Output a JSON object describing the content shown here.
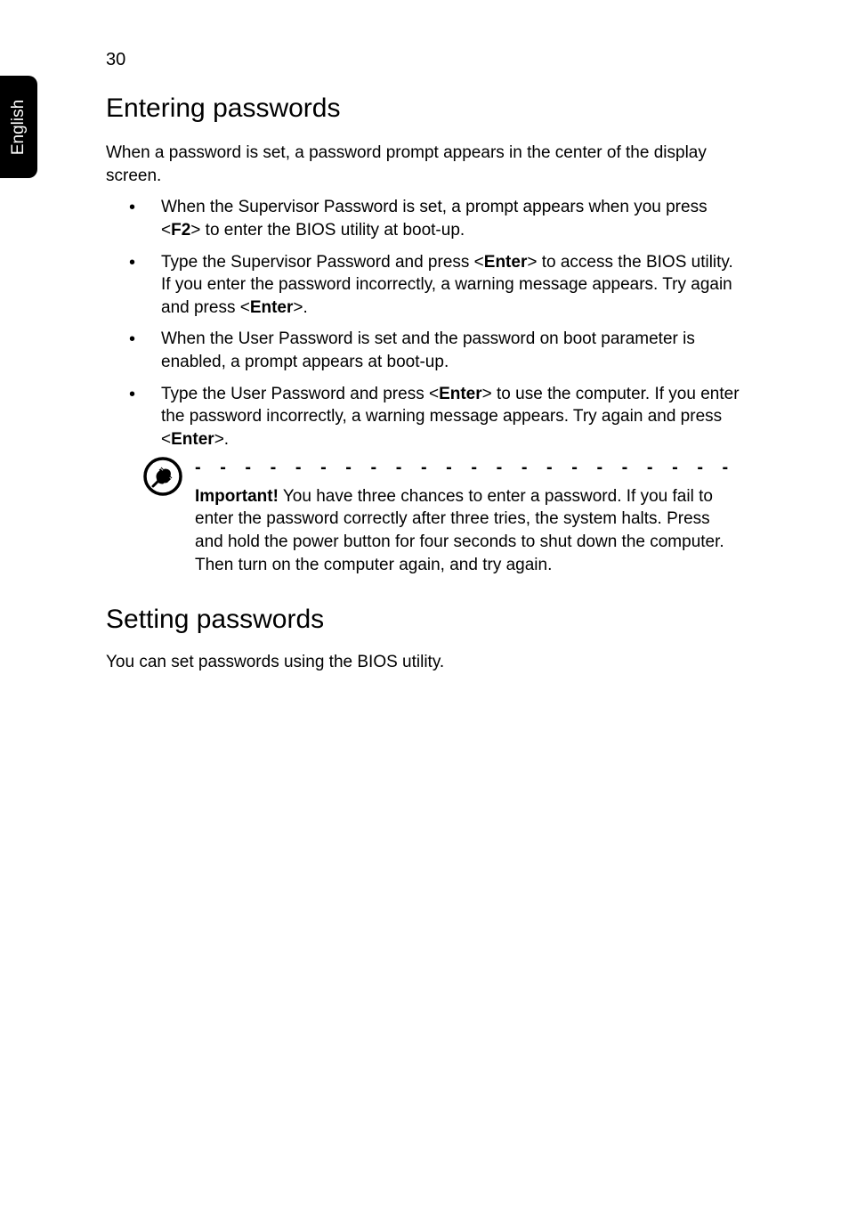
{
  "page_number": "30",
  "side_tab": "English",
  "section1": {
    "heading": "Entering passwords",
    "intro": "When a password is set, a password prompt appears in the center of the display screen.",
    "bullets": [
      {
        "prefix": "When the Supervisor Password is set, a prompt appears when you press <",
        "key1": "F2",
        "suffix": "> to enter the BIOS utility at boot-up."
      },
      {
        "prefix": "Type the Supervisor Password and press <",
        "key1": "Enter",
        "mid": "> to access the BIOS utility. If you enter the password incorrectly, a warning message appears. Try again and press <",
        "key2": "Enter",
        "suffix": ">."
      },
      {
        "prefix": "When the User Password is set and the password on boot parameter is enabled, a prompt appears at boot-up."
      },
      {
        "prefix": "Type the User Password and press <",
        "key1": "Enter",
        "mid": "> to use the computer. If you enter the password incorrectly, a warning message appears. Try again and press <",
        "key2": "Enter",
        "suffix": ">."
      }
    ],
    "note": {
      "important_label": "Important!",
      "text": " You have three chances to enter a password. If you fail to enter the password correctly after three tries, the system halts. Press and hold the power button for four seconds to shut down the computer. Then turn on the computer again, and try again."
    }
  },
  "section2": {
    "heading": "Setting passwords",
    "body": "You can set passwords using the BIOS utility."
  }
}
